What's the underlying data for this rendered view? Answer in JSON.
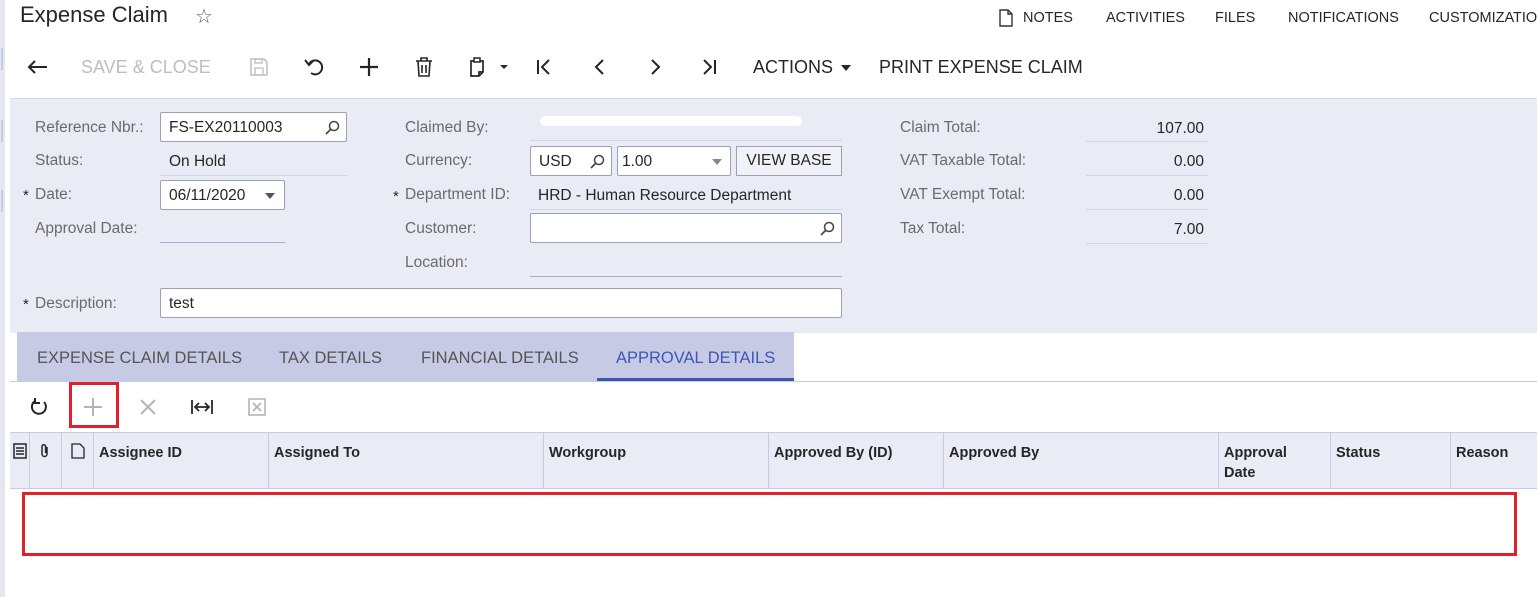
{
  "header": {
    "title": "Expense Claim",
    "nav": [
      "NOTES",
      "ACTIVITIES",
      "FILES",
      "NOTIFICATIONS",
      "CUSTOMIZATION"
    ]
  },
  "toolbar": {
    "save_close": "SAVE & CLOSE",
    "actions": "ACTIONS",
    "print": "PRINT EXPENSE CLAIM"
  },
  "form": {
    "reference_nbr_label": "Reference Nbr.:",
    "reference_nbr": "FS-EX20110003",
    "status_label": "Status:",
    "status": "On Hold",
    "date_label": "Date:",
    "date": "06/11/2020",
    "approval_date_label": "Approval Date:",
    "claimed_by_label": "Claimed By:",
    "currency_label": "Currency:",
    "currency": "USD",
    "rate": "1.00",
    "view_base": "VIEW BASE",
    "department_label": "Department ID:",
    "department": "HRD - Human Resource Department",
    "customer_label": "Customer:",
    "location_label": "Location:",
    "description_label": "Description:",
    "description": "test",
    "required_mark": "*",
    "claim_total_label": "Claim Total:",
    "claim_total": "107.00",
    "vat_taxable_label": "VAT Taxable Total:",
    "vat_taxable": "0.00",
    "vat_exempt_label": "VAT Exempt Total:",
    "vat_exempt": "0.00",
    "tax_total_label": "Tax Total:",
    "tax_total": "7.00"
  },
  "tabs": [
    {
      "label": "EXPENSE CLAIM DETAILS"
    },
    {
      "label": "TAX DETAILS"
    },
    {
      "label": "FINANCIAL DETAILS"
    },
    {
      "label": "APPROVAL DETAILS",
      "active": true
    }
  ],
  "grid": {
    "columns": [
      "Assignee ID",
      "Assigned To",
      "Workgroup",
      "Approved By (ID)",
      "Approved By",
      "Approval Date",
      "Status",
      "Reason"
    ],
    "rows": []
  },
  "colors": {
    "accent": "#3e57b6",
    "highlight": "#e0202a",
    "form_bg": "#e9ebf5",
    "tab_bg": "#c6cae4"
  }
}
